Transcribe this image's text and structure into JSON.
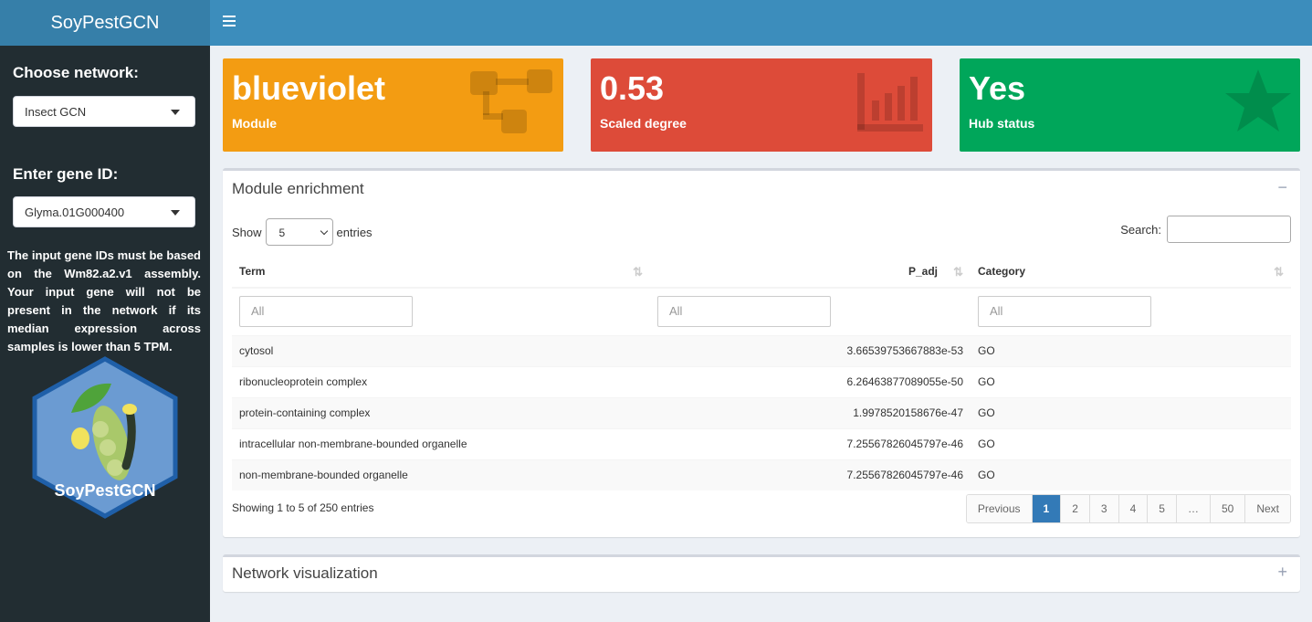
{
  "app": {
    "title": "SoyPestGCN"
  },
  "sidebar": {
    "network_label": "Choose network:",
    "network_value": "Insect GCN",
    "gene_label": "Enter gene ID:",
    "gene_value": "Glyma.01G000400",
    "note": "The input gene IDs must be based on the Wm82.a2.v1 assembly. Your input gene will not be present in the network if its median expression across samples is lower than 5 TPM.",
    "logo_text": "SoyPestGCN"
  },
  "value_boxes": [
    {
      "value": "blueviolet",
      "label": "Module",
      "color": "#f39c12",
      "icon": "sitemap-icon"
    },
    {
      "value": "0.53",
      "label": "Scaled degree",
      "color": "#dd4b39",
      "icon": "bar-chart-icon"
    },
    {
      "value": "Yes",
      "label": "Hub status",
      "color": "#00a65a",
      "icon": "star-icon"
    }
  ],
  "enrichment": {
    "title": "Module enrichment",
    "show_label": "Show",
    "entries_label": "entries",
    "length_value": "5",
    "search_label": "Search:",
    "columns": [
      "Term",
      "P_adj",
      "Category"
    ],
    "filter_placeholder": "All",
    "rows": [
      {
        "term": "cytosol",
        "p_adj": "3.66539753667883e-53",
        "category": "GO"
      },
      {
        "term": "ribonucleoprotein complex",
        "p_adj": "6.26463877089055e-50",
        "category": "GO"
      },
      {
        "term": "protein-containing complex",
        "p_adj": "1.9978520158676e-47",
        "category": "GO"
      },
      {
        "term": "intracellular non-membrane-bounded organelle",
        "p_adj": "7.25567826045797e-46",
        "category": "GO"
      },
      {
        "term": "non-membrane-bounded organelle",
        "p_adj": "7.25567826045797e-46",
        "category": "GO"
      }
    ],
    "info": "Showing 1 to 5 of 250 entries",
    "pagination": [
      "Previous",
      "1",
      "2",
      "3",
      "4",
      "5",
      "…",
      "50",
      "Next"
    ],
    "active_page": "1"
  },
  "network": {
    "title": "Network visualization"
  },
  "colors": {
    "header": "#3c8dbc",
    "logo_bg": "#367fa9",
    "sidebar": "#222d32"
  }
}
